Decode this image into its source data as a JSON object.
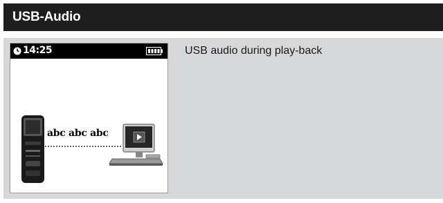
{
  "header": {
    "title": "USB-Audio"
  },
  "device_screen": {
    "time": "14:25",
    "clock_icon": "clock-icon",
    "battery_icon": "battery-full-icon",
    "transfer_text": "abc abc abc",
    "player_icon": "media-player-device-icon",
    "computer_icon": "computer-monitor-play-icon"
  },
  "description": "USB audio during play-back",
  "colors": {
    "title_bar": "#1e1e1e",
    "content_bg": "#d7d8da",
    "screen_bg": "#ffffff",
    "status_bar": "#000000"
  }
}
